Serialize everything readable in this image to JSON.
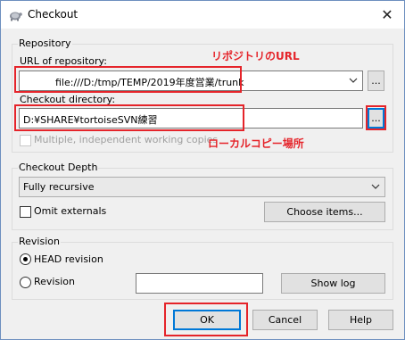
{
  "window": {
    "title": "Checkout",
    "icon": "tortoise-icon",
    "close_glyph": "✕"
  },
  "repository": {
    "group_label": "Repository",
    "url_label": "URL of repository:",
    "url_value": "file:///D:/tmp/TEMP/2019年度営業/trunk",
    "url_browse": "...",
    "checkout_dir_label": "Checkout directory:",
    "checkout_dir_value": "D:¥SHARE¥tortoiseSVN練習",
    "checkout_dir_browse": "...",
    "multiple_label": "Multiple, independent working copies",
    "multiple_checked": false,
    "multiple_disabled": true
  },
  "annotations": {
    "url_note": "リポジトリのURL",
    "local_note": "ローカルコピー場所",
    "color": "#e5242a"
  },
  "depth": {
    "group_label": "Checkout Depth",
    "selected": "Fully recursive",
    "omit_externals_label": "Omit externals",
    "omit_externals_checked": false,
    "choose_items_label": "Choose items..."
  },
  "revision": {
    "group_label": "Revision",
    "head_label": "HEAD revision",
    "head_selected": true,
    "revision_label": "Revision",
    "revision_value": "",
    "show_log_label": "Show log"
  },
  "footer": {
    "ok_label": "OK",
    "cancel_label": "Cancel",
    "help_label": "Help"
  }
}
